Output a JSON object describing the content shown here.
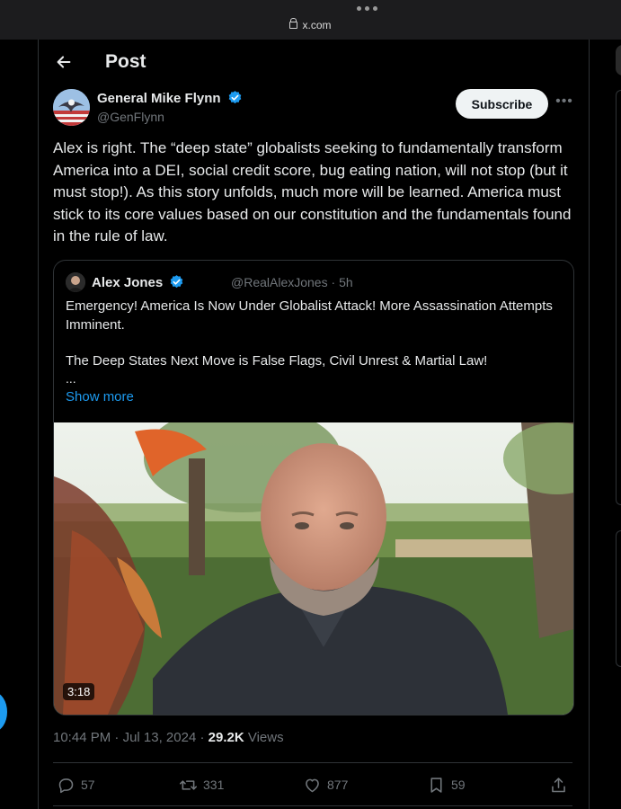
{
  "browser": {
    "url": "x.com"
  },
  "header": {
    "title": "Post"
  },
  "author": {
    "name": "General Mike Flynn",
    "handle": "@GenFlynn"
  },
  "subscribe_label": "Subscribe",
  "post_text": "Alex is right. The “deep state” globalists seeking to fundamentally transform America into a DEI, social credit score, bug eating nation, will not stop (but it must stop!). As this story unfolds, much more will be learned. America must stick to its core values based on our constitution and the fundamentals found in the rule of law.",
  "quote": {
    "name": "Alex Jones",
    "handle": "@RealAlexJones",
    "time": "5h",
    "line1": "Emergency! America Is Now Under Globalist Attack! More Assassination Attempts Imminent.",
    "line2": "The Deep States Next Move is False Flags, Civil Unrest & Martial Law!",
    "ellipsis": "...",
    "show_more": "Show more",
    "video_duration": "3:18"
  },
  "meta": {
    "time": "10:44 PM",
    "date": "Jul 13, 2024",
    "views_count": "29.2K",
    "views_label": "Views"
  },
  "actions": {
    "replies": "57",
    "reposts": "331",
    "likes": "877",
    "bookmarks": "59"
  },
  "colors": {
    "accent": "#1d9bf0",
    "background": "#000000",
    "muted": "#71767b"
  },
  "icons": [
    "back-arrow-icon",
    "verified-badge-icon",
    "more-options-icon",
    "reply-icon",
    "repost-icon",
    "like-icon",
    "bookmark-icon",
    "share-icon"
  ]
}
